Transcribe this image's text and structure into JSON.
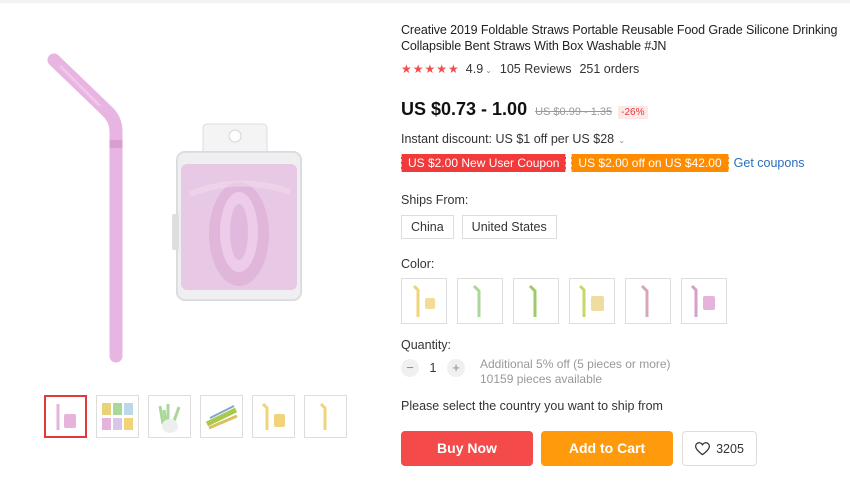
{
  "product": {
    "title": "Creative 2019 Foldable Straws Portable Reusable Food Grade Silicone Drinking Collapsible Bent Straws With Box Washable #JN",
    "stars": "★★★★★",
    "rating": "4.9",
    "reviews": "105 Reviews",
    "orders": "251 orders",
    "price": "US $0.73 - 1.00",
    "old_price": "US $0.99 - 1.35",
    "discount": "-26%",
    "instant_discount": "Instant discount: US $1 off per US $28",
    "coupons": {
      "new_user": "US $2.00 New User Coupon",
      "off": "US $2.00 off on US $42.00",
      "get": "Get coupons"
    },
    "ships_from_label": "Ships From:",
    "ship_options": [
      "China",
      "United States"
    ],
    "color_label": "Color:",
    "quantity_label": "Quantity:",
    "quantity": "1",
    "qty_minus": "−",
    "qty_plus": "+",
    "qty_note_1": "Additional 5% off (5 pieces or more)",
    "qty_note_2": "10159 pieces available",
    "select_country": "Please select the country you want to ship from",
    "buy_now": "Buy Now",
    "add_to_cart": "Add to Cart",
    "wishlist_count": "3205"
  },
  "colors": {
    "pink": "#e6b3db",
    "yellow": "#f1d47a",
    "green": "#a9d89a",
    "red": "#f44a4a",
    "orange": "#ff9a0d"
  }
}
